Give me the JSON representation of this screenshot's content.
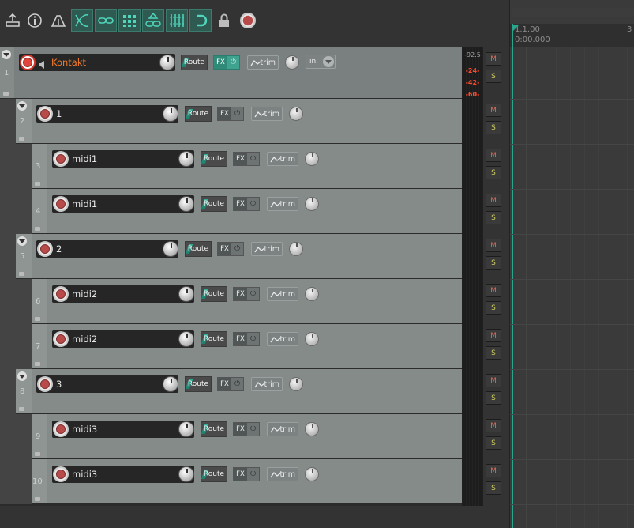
{
  "toolbar": {
    "buttons": [
      {
        "name": "metronome-tool-icon",
        "style": "plain"
      },
      {
        "name": "info-icon",
        "style": "plain"
      },
      {
        "name": "auto-crossfade-icon",
        "style": "plain"
      },
      {
        "name": "crossfade-toggle-icon",
        "style": "green"
      },
      {
        "name": "item-grouping-icon",
        "style": "green"
      },
      {
        "name": "snap-grid-icon",
        "style": "green"
      },
      {
        "name": "ripple-edit-icon",
        "style": "green"
      },
      {
        "name": "envelope-lock-icon",
        "style": "green"
      },
      {
        "name": "loop-icon",
        "style": "green"
      },
      {
        "name": "lock-icon",
        "style": "plain"
      },
      {
        "name": "record-icon",
        "style": "plain"
      }
    ]
  },
  "meter": {
    "peak_label": "-92.5",
    "scale_labels": [
      "-24-",
      "-42-",
      "-60-"
    ]
  },
  "tracks": [
    {
      "num": "1",
      "name": "Kontakt",
      "kind": "master",
      "armed": true,
      "fx_active": true,
      "route_label": "Route",
      "fx_label": "FX",
      "trim_label": "trim",
      "input_label": "in",
      "mute": "M",
      "solo": "S"
    },
    {
      "num": "2",
      "name": "1",
      "kind": "folder",
      "armed": false,
      "fx_active": false,
      "route_label": "Route",
      "fx_label": "FX",
      "trim_label": "trim",
      "mute": "M",
      "solo": "S"
    },
    {
      "num": "3",
      "name": "midi1",
      "kind": "child",
      "armed": false,
      "fx_active": false,
      "route_label": "Route",
      "fx_label": "FX",
      "trim_label": "trim",
      "mute": "M",
      "solo": "S"
    },
    {
      "num": "4",
      "name": "midi1",
      "kind": "child",
      "armed": false,
      "fx_active": false,
      "route_label": "Route",
      "fx_label": "FX",
      "trim_label": "trim",
      "mute": "M",
      "solo": "S"
    },
    {
      "num": "5",
      "name": "2",
      "kind": "folder",
      "armed": false,
      "fx_active": false,
      "route_label": "Route",
      "fx_label": "FX",
      "trim_label": "trim",
      "mute": "M",
      "solo": "S"
    },
    {
      "num": "6",
      "name": "midi2",
      "kind": "child",
      "armed": false,
      "fx_active": false,
      "route_label": "Route",
      "fx_label": "FX",
      "trim_label": "trim",
      "mute": "M",
      "solo": "S"
    },
    {
      "num": "7",
      "name": "midi2",
      "kind": "child",
      "armed": false,
      "fx_active": false,
      "route_label": "Route",
      "fx_label": "FX",
      "trim_label": "trim",
      "mute": "M",
      "solo": "S"
    },
    {
      "num": "8",
      "name": "3",
      "kind": "folder",
      "armed": false,
      "fx_active": false,
      "route_label": "Route",
      "fx_label": "FX",
      "trim_label": "trim",
      "mute": "M",
      "solo": "S"
    },
    {
      "num": "9",
      "name": "midi3",
      "kind": "child",
      "armed": false,
      "fx_active": false,
      "route_label": "Route",
      "fx_label": "FX",
      "trim_label": "trim",
      "mute": "M",
      "solo": "S"
    },
    {
      "num": "10",
      "name": "midi3",
      "kind": "child",
      "armed": false,
      "fx_active": false,
      "route_label": "Route",
      "fx_label": "FX",
      "trim_label": "trim",
      "mute": "M",
      "solo": "S"
    }
  ],
  "ruler": {
    "bar_label": "1.1.00",
    "time_label": "0:00.000",
    "next_bar_label": "3"
  },
  "colors": {
    "accent": "#2aa58d",
    "armed_track_name": "#f47c2c",
    "meter_text": "#ff4a2a"
  }
}
